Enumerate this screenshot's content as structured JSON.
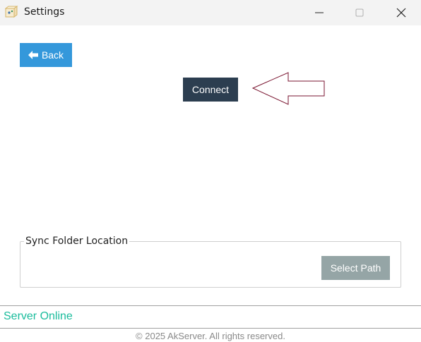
{
  "window": {
    "title": "Settings",
    "icon": "app-cube-icon",
    "controls": [
      "minimize-icon",
      "maximize-icon",
      "close-icon"
    ]
  },
  "toolbar": {
    "back_label": "Back",
    "back_icon": "arrow-left-icon"
  },
  "main": {
    "connect_label": "Connect"
  },
  "sync_folder": {
    "legend": "Sync Folder Location",
    "select_path_label": "Select Path"
  },
  "status": {
    "text": "Server Online",
    "color": "#1abc9c"
  },
  "footer": {
    "copyright": "© 2025 AkServer. All rights reserved."
  },
  "colors": {
    "back_button": "#3498db",
    "connect_button": "#2c3e50",
    "select_path_button": "#95a5a6",
    "annotation_arrow": "#7a1530"
  }
}
